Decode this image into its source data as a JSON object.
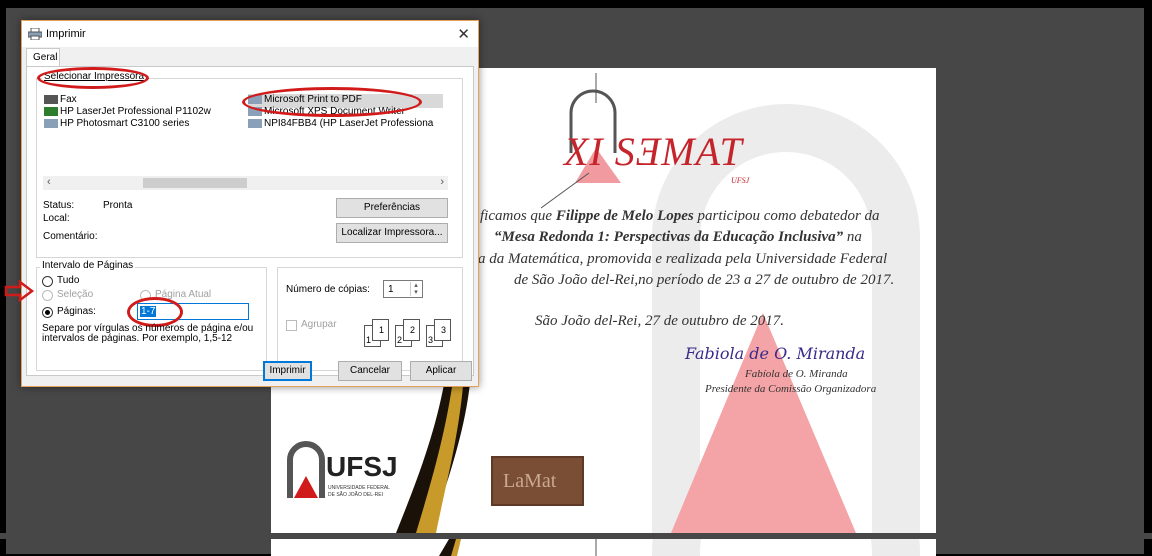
{
  "dialog": {
    "title": "Imprimir",
    "tab": "Geral",
    "select_printer_label": "Selecionar Impressora",
    "printers": [
      "Fax",
      "HP LaserJet Professional P1102w",
      "HP Photosmart C3100 series",
      "Microsoft Print to PDF",
      "Microsoft XPS Document Writer",
      "NPI84FBB4 (HP LaserJet Professiona"
    ],
    "status_label": "Status:",
    "status_value": "Pronta",
    "local_label": "Local:",
    "comment_label": "Comentário:",
    "preferences_button": "Preferências",
    "find_printer_button": "Localizar Impressora...",
    "page_range_label": "Intervalo de Páginas",
    "range_all": "Tudo",
    "range_selection": "Seleção",
    "range_current": "Página Atual",
    "range_pages": "Páginas:",
    "pages_value": "1-7",
    "pages_hint_1": "Separe por vírgulas os números de página e/ou",
    "pages_hint_2": "intervalos de páginas. Por exemplo, 1,5-12",
    "copies_label": "Número de cópias:",
    "copies_value": "1",
    "collate_label": "Agrupar",
    "collate_icons": [
      "1",
      "1",
      "2",
      "2",
      "3",
      "3"
    ],
    "print_button": "Imprimir",
    "cancel_button": "Cancelar",
    "apply_button": "Aplicar"
  },
  "certificate": {
    "event_logo": "XI SƎMAT",
    "event_logo_sub": "UFSJ",
    "line1_prefix": "ficamos que ",
    "line1_name": "Filippe de Melo Lopes",
    "line1_suffix": " participou como debatedor da",
    "line2_bold": "“Mesa Redonda 1: Perspectivas da Educação Inclusiva”",
    "line2_suffix": " na",
    "line3": "a da Matemática, promovida e realizada pela Universidade Federal",
    "line4": "de São João del-Rei,no período de 23 a 27 de outubro de 2017.",
    "date_line": "São João del-Rei, 27 de outubro de 2017.",
    "signature_script": "Fabiola de O. Miranda",
    "signer_name": "Fabíola de O. Miranda",
    "signer_role": "Presidente da Comissão Organizadora",
    "ufsj_logo": "UFSJ",
    "ufsj_sub_1": "UNIVERSIDADE FEDERAL",
    "ufsj_sub_2": "DE SÃO JOÃO DEL-REI",
    "lamat_logo": "LaMat"
  },
  "colors": {
    "accent_red": "#d11b1b",
    "emblem_red": "#e8313a",
    "watermark_pink": "#f4a3a6",
    "gold": "#c79a2a"
  }
}
